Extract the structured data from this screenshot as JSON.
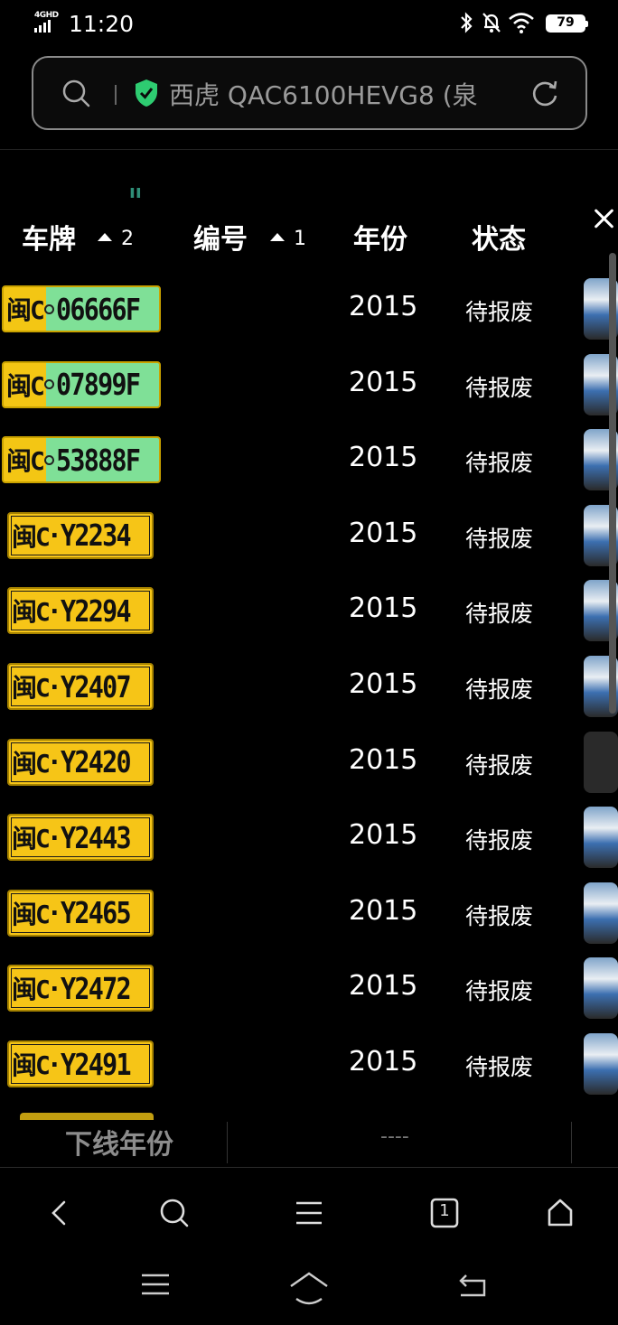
{
  "status_bar": {
    "network": "4GHD",
    "time": "11:20",
    "battery": "79"
  },
  "url_bar": {
    "text": "西虎 QAC6100HEVG8 (泉"
  },
  "header": {
    "small_glyph": "ıı",
    "col_plate": "车牌",
    "col_plate_sort": "2",
    "col_number": "编号",
    "col_number_sort": "1",
    "col_year": "年份",
    "col_status": "状态"
  },
  "rows": [
    {
      "prov": "闽C",
      "num": "06666F",
      "type": "green",
      "year": "2015",
      "status": "待报废"
    },
    {
      "prov": "闽C",
      "num": "07899F",
      "type": "green",
      "year": "2015",
      "status": "待报废"
    },
    {
      "prov": "闽C",
      "num": "53888F",
      "type": "green",
      "year": "2015",
      "status": "待报废"
    },
    {
      "prov": "闽C",
      "num": "Y2234",
      "type": "yellow",
      "year": "2015",
      "status": "待报废"
    },
    {
      "prov": "闽C",
      "num": "Y2294",
      "type": "yellow",
      "year": "2015",
      "status": "待报废"
    },
    {
      "prov": "闽C",
      "num": "Y2407",
      "type": "yellow",
      "year": "2015",
      "status": "待报废"
    },
    {
      "prov": "闽C",
      "num": "Y2420",
      "type": "yellow",
      "year": "2015",
      "status": "待报废"
    },
    {
      "prov": "闽C",
      "num": "Y2443",
      "type": "yellow",
      "year": "2015",
      "status": "待报废"
    },
    {
      "prov": "闽C",
      "num": "Y2465",
      "type": "yellow",
      "year": "2015",
      "status": "待报废"
    },
    {
      "prov": "闽C",
      "num": "Y2472",
      "type": "yellow",
      "year": "2015",
      "status": "待报废"
    },
    {
      "prov": "闽C",
      "num": "Y2491",
      "type": "yellow",
      "year": "2015",
      "status": "待报废"
    }
  ],
  "detail": {
    "label": "下线年份",
    "value": "----"
  },
  "browser_bar": {
    "tabs_count": "1"
  },
  "colors": {
    "plate_yellow": "#f6c517",
    "plate_green": "#7fe097",
    "shield_green": "#2ecc71"
  }
}
